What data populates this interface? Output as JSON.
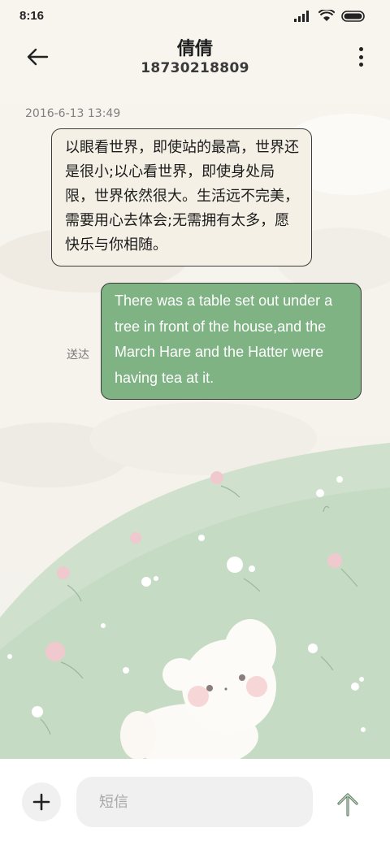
{
  "status_bar": {
    "time": "8:16",
    "icons": [
      "signal-icon",
      "wifi-icon",
      "battery-icon"
    ]
  },
  "header": {
    "contact_name": "倩倩",
    "contact_number": "18730218809",
    "back_icon": "arrow-left-icon",
    "more_icon": "more-vertical-icon"
  },
  "conversation": {
    "timestamp": "2016-6-13 13:49",
    "incoming_message": "以眼看世界，即使站的最高，世界还是很小;以心看世界，即使身处局限，世界依然很大。生活远不完美，需要用心去体会;无需拥有太多，愿快乐与你相随。",
    "outgoing_message": "There was a table set out under a tree in front of the house,and the March Hare and the Hatter were having tea at it.",
    "delivery_status": "送达"
  },
  "composer": {
    "placeholder": "短信",
    "add_icon": "plus-icon",
    "send_icon": "arrow-up-icon"
  },
  "colors": {
    "incoming_bubble": "#f4f0e6",
    "outgoing_bubble": "#7fb384",
    "hill_green": "#c9dcc7",
    "background": "#f7f4ee"
  }
}
